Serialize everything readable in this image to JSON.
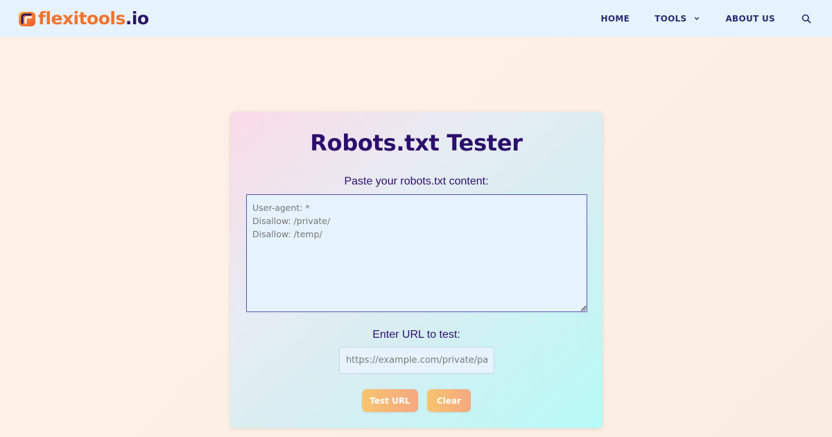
{
  "header": {
    "logo": {
      "brand": "flexitools",
      "tld": ".io"
    },
    "nav": {
      "home": "HOME",
      "tools": "TOOLS",
      "about": "ABOUT US"
    },
    "icons": {
      "logo": "flexitools-logo-icon",
      "tools_dropdown": "chevron-down-icon",
      "search": "search-icon"
    }
  },
  "tool": {
    "title": "Robots.txt Tester",
    "robots_label": "Paste your robots.txt content:",
    "robots_placeholder": "User-agent: *\nDisallow: /private/\nDisallow: /temp/",
    "url_label": "Enter URL to test:",
    "url_placeholder": "https://example.com/private/page",
    "test_button": "Test URL",
    "clear_button": "Clear"
  },
  "colors": {
    "brand_orange": "#f0732f",
    "brand_navy": "#2a1466",
    "title": "#2c0f6b",
    "button_start": "#f7c46f",
    "button_end": "#f5a882"
  }
}
